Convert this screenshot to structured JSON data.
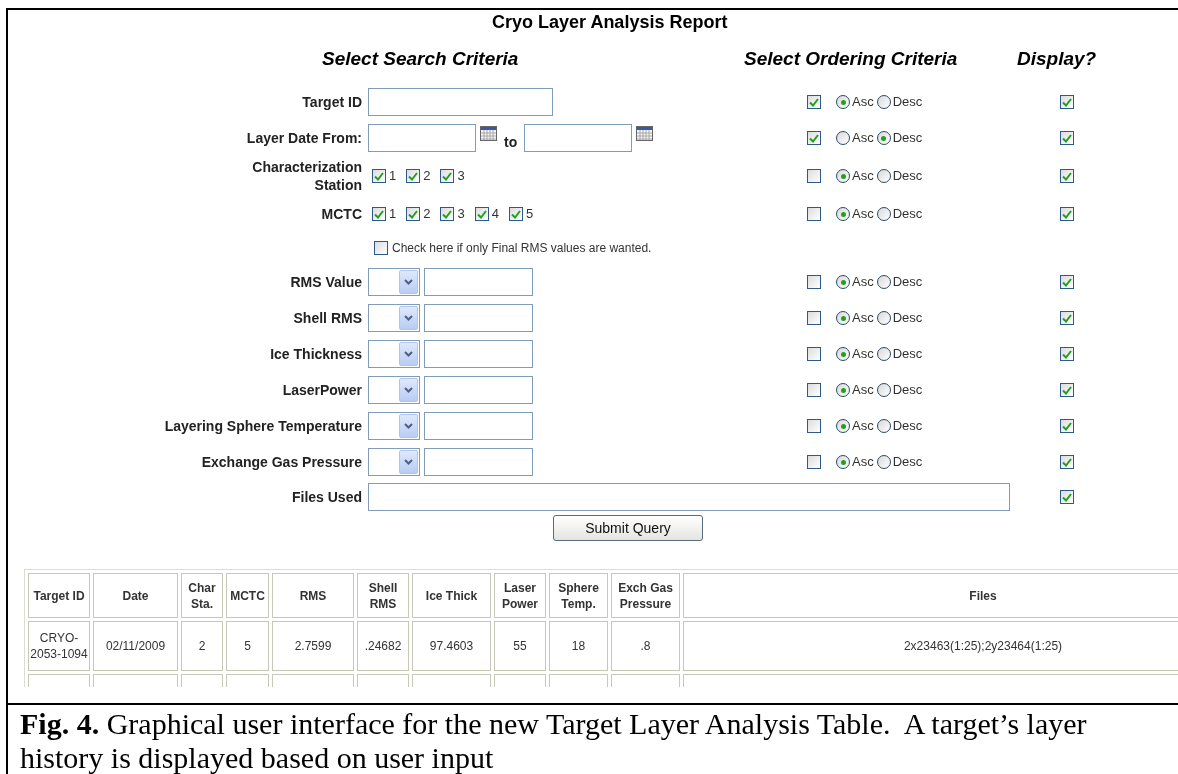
{
  "title": "Cryo Layer Analysis Report",
  "headers": {
    "search": "Select Search Criteria",
    "ordering": "Select Ordering Criteria",
    "display": "Display?"
  },
  "criteria": [
    {
      "kind": "text",
      "label": "Target ID",
      "order": {
        "checked": true,
        "options": [
          {
            "label": "Asc",
            "selected": true
          },
          {
            "label": "Desc",
            "selected": false
          }
        ]
      },
      "display": true
    },
    {
      "kind": "date_range",
      "label": "Layer Date From:",
      "joiner": "to",
      "order": {
        "checked": true,
        "options": [
          {
            "label": "Asc",
            "selected": false
          },
          {
            "label": "Desc",
            "selected": true
          }
        ]
      },
      "display": true
    },
    {
      "kind": "checkbox_group",
      "label": "Characterization Station",
      "options": [
        {
          "label": "1",
          "checked": true
        },
        {
          "label": "2",
          "checked": true
        },
        {
          "label": "3",
          "checked": true
        }
      ],
      "order": {
        "checked": false,
        "options": [
          {
            "label": "Asc",
            "selected": true
          },
          {
            "label": "Desc",
            "selected": false
          }
        ]
      },
      "display": true
    },
    {
      "kind": "checkbox_group",
      "label": "MCTC",
      "options": [
        {
          "label": "1",
          "checked": true
        },
        {
          "label": "2",
          "checked": true
        },
        {
          "label": "3",
          "checked": true
        },
        {
          "label": "4",
          "checked": true
        },
        {
          "label": "5",
          "checked": true
        }
      ],
      "order": {
        "checked": false,
        "options": [
          {
            "label": "Asc",
            "selected": true
          },
          {
            "label": "Desc",
            "selected": false
          }
        ]
      },
      "display": true
    },
    {
      "kind": "note",
      "label": "Check here if only Final RMS values are wanted.",
      "checked": false
    },
    {
      "kind": "compare",
      "label": "RMS Value",
      "order": {
        "checked": false,
        "options": [
          {
            "label": "Asc",
            "selected": true
          },
          {
            "label": "Desc",
            "selected": false
          }
        ]
      },
      "display": true
    },
    {
      "kind": "compare",
      "label": "Shell RMS",
      "order": {
        "checked": false,
        "options": [
          {
            "label": "Asc",
            "selected": true
          },
          {
            "label": "Desc",
            "selected": false
          }
        ]
      },
      "display": true
    },
    {
      "kind": "compare",
      "label": "Ice Thickness",
      "order": {
        "checked": false,
        "options": [
          {
            "label": "Asc",
            "selected": true
          },
          {
            "label": "Desc",
            "selected": false
          }
        ]
      },
      "display": true
    },
    {
      "kind": "compare",
      "label": "LaserPower",
      "order": {
        "checked": false,
        "options": [
          {
            "label": "Asc",
            "selected": true
          },
          {
            "label": "Desc",
            "selected": false
          }
        ]
      },
      "display": true
    },
    {
      "kind": "compare",
      "label": "Layering Sphere Temperature",
      "order": {
        "checked": false,
        "options": [
          {
            "label": "Asc",
            "selected": true
          },
          {
            "label": "Desc",
            "selected": false
          }
        ]
      },
      "display": true
    },
    {
      "kind": "compare",
      "label": "Exchange Gas Pressure",
      "order": {
        "checked": false,
        "options": [
          {
            "label": "Asc",
            "selected": true
          },
          {
            "label": "Desc",
            "selected": false
          }
        ]
      },
      "display": true
    },
    {
      "kind": "wide_text",
      "label": "Files Used",
      "display": true
    }
  ],
  "submit": "Submit Query",
  "table": {
    "columns": [
      "Target ID",
      "Date",
      "Char Sta.",
      "MCTC",
      "RMS",
      "Shell RMS",
      "Ice Thick",
      "Laser Power",
      "Sphere Temp.",
      "Exch Gas Pressure",
      "Files"
    ],
    "rows": [
      [
        "CRYO-2053-1094",
        "02/11/2009",
        "2",
        "5",
        "2.7599",
        ".24682",
        "97.4603",
        "55",
        "18",
        ".8",
        "2x23463(1:25);2y23464(1:25)"
      ]
    ]
  },
  "caption": "**Fig. 4.** Graphical user interface for the new Target Layer Analysis Table.  A target’s layer history is displayed based on user input"
}
